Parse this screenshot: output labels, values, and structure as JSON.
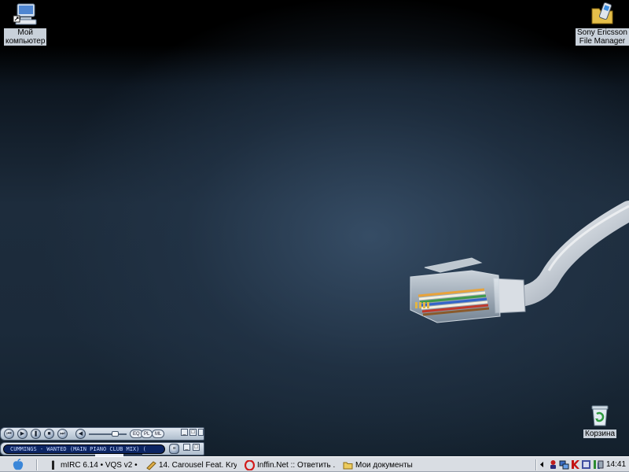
{
  "desktop": {
    "icons": [
      {
        "label": "Мой\nкомпьютер",
        "icon": "my-computer-icon"
      },
      {
        "label": "Sony Ericsson\nFile Manager",
        "icon": "phone-folder-icon"
      },
      {
        "label": "Корзина",
        "icon": "recycle-bin-icon"
      }
    ],
    "wallpaper": "ethernet-cable-rj45-plug"
  },
  "player": {
    "now_playing": "CUMMINGS - WANTED (MAIN PIANO CLUB MIX) (",
    "pill_labels": [
      "EQ",
      "PL",
      "ML"
    ],
    "volume": 0.62,
    "progress": 0.6,
    "buttons": [
      "previous",
      "play",
      "pause",
      "stop",
      "next",
      "mute"
    ]
  },
  "taskbar": {
    "tasks": [
      {
        "label": "mIRC 6.14 • VQS v2 • ...",
        "icon": "mirc-icon"
      },
      {
        "label": "14. Carousel Feat. Kry...",
        "icon": "winamp-icon"
      },
      {
        "label": "Inffin.Net :: Ответить ...",
        "icon": "opera-icon"
      },
      {
        "label": "Мои документы",
        "icon": "folder-icon"
      }
    ],
    "tray_icons": [
      "tray-expand-icon",
      "tray-agent-icon",
      "tray-network-icon",
      "tray-kaspersky-icon",
      "tray-app-icon",
      "tray-messenger-icon",
      "tray-display-icon"
    ],
    "clock": "14:41"
  },
  "colors": {
    "taskbar": "#d9dde3",
    "desktop_top": "#000000",
    "desktop_mid": "#1d2c3c",
    "ticker_bg": "#0b2462"
  }
}
